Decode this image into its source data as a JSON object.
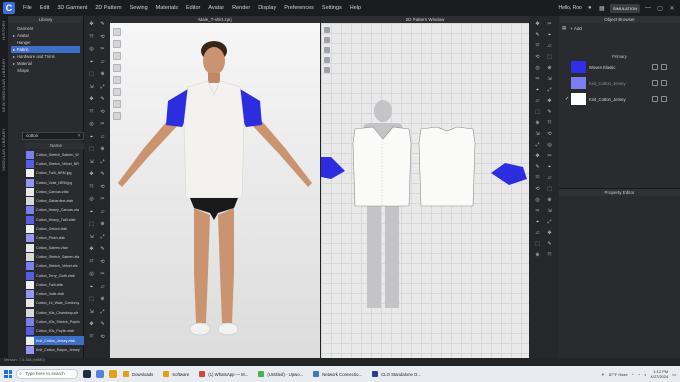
{
  "menu": {
    "items": [
      "File",
      "Edit",
      "3D Garment",
      "2D Pattern",
      "Sewing",
      "Materials",
      "Editor",
      "Avatar",
      "Render",
      "Display",
      "Preferences",
      "Settings",
      "Help"
    ],
    "hello": "Hello, Roo",
    "mode_badge": "SIMULATION"
  },
  "left_strip": {
    "tabs": [
      "HISTORY",
      "NEW MODULAR LIBRARY",
      "MODULAR LIBRARY"
    ]
  },
  "library": {
    "title": "Library",
    "tree": [
      {
        "label": "Garment",
        "level": 1,
        "selected": false
      },
      {
        "label": "Avatar",
        "level": 1,
        "selected": false
      },
      {
        "label": "Hanger",
        "level": 1,
        "selected": false
      },
      {
        "label": "Fabric",
        "level": 1,
        "selected": true
      },
      {
        "label": "Hardware and Trims",
        "level": 1,
        "selected": false
      },
      {
        "label": "Material",
        "level": 1,
        "selected": false
      },
      {
        "label": "Shape",
        "level": 1,
        "selected": false
      }
    ],
    "search_value": "cotton",
    "column_header": "Name",
    "files": [
      "Cotton_Stretch_Sateen_W",
      "Cotton_Stretch_Velvet_NR",
      "Cotton_Twill_NRM.jpg",
      "Cotton_Voile_NRM.jpg",
      "Cotton_Canvas.zfab",
      "Cotton_Gabardine.zfab",
      "Cotton_Heavy_Canvas.zfa",
      "Cotton_Heavy_Twill.zfab",
      "Cotton_Oxford.zfab",
      "Cotton_Plush.zfab",
      "Cotton_Sateen.zfab",
      "Cotton_Stretch_Sateen.zfa",
      "Cotton_Stretch_Velvet.zfa",
      "Cotton_Terry_Cloth.zfab",
      "Cotton_Twill.zfab",
      "Cotton_Voile.zfab",
      "Cotton_14_Wale_Corduroy",
      "Cotton_40s_Chambray.zfa",
      "Cotton_40s_Stretch_Poplin",
      "Cotton_50s_Poplin.zfab",
      "Knit_Cotton_Jersey.zfab",
      "Knit_Cotton_Rayon_Jersey"
    ],
    "selected_file": "Knit_Cotton_Jersey.zfab"
  },
  "version": "Version: 7.0.168 (r4980)",
  "viewport3d": {
    "title": "Male_T-shirt.zprj"
  },
  "viewport2d": {
    "title": "2D Pattern Window"
  },
  "object_browser": {
    "title": "Object Browser",
    "add_label": "+ Add",
    "tab": "Primary",
    "fabrics": [
      {
        "name": "Woven Elastic",
        "color": "#2f2ee8",
        "dim": false,
        "checked": false
      },
      {
        "name": "Knit_Cotton_Jersey",
        "color": "#7b7ef0",
        "dim": true,
        "checked": false
      },
      {
        "name": "Knit_Cotton_Jersey",
        "color": "#ffffff",
        "dim": false,
        "checked": true
      }
    ]
  },
  "property_editor": {
    "title": "Property Editor"
  },
  "taskbar": {
    "search_placeholder": "Type here to search",
    "apps": [
      "Downloads",
      "Software",
      "(1) WhatsApp — M...",
      "(Untitled) - Upwo...",
      "Network Connectio...",
      "CLO Standalone O..."
    ],
    "weather": "87°F Haze",
    "time": "1:12 PM",
    "date": "4/27/2024"
  },
  "colors": {
    "accent_blue": "#3d6fc6",
    "sleeve_blue": "#2d2de0",
    "shirt_white": "#f4f2ee"
  }
}
